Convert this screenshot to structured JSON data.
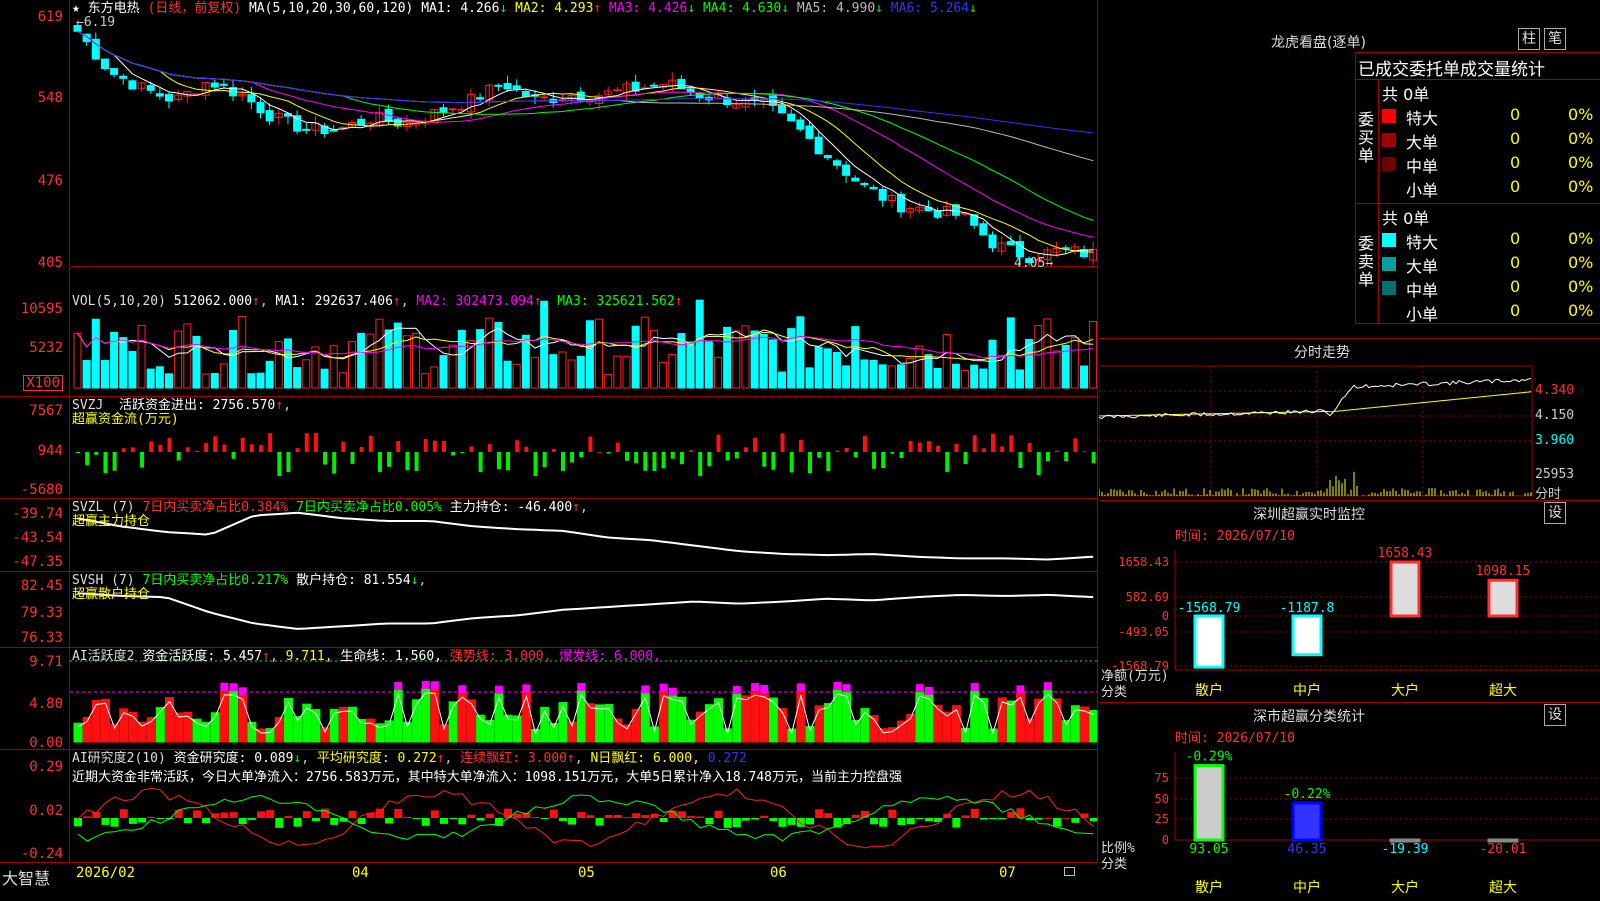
{
  "stock": {
    "name": "东方电热",
    "mode": "(日线，前复权)",
    "high_label": "6.19",
    "low_label": "4.05",
    "star": "★"
  },
  "ma_header": {
    "params": "MA(5,10,20,30,60,120)",
    "items": [
      {
        "label": "MA1:",
        "value": "4.266",
        "arrow": "↓",
        "color": "#ffffff"
      },
      {
        "label": "MA2:",
        "value": "4.293",
        "arrow": "↑",
        "color": "#ffff00"
      },
      {
        "label": "MA3:",
        "value": "4.426",
        "arrow": "↓",
        "color": "#ff00ff"
      },
      {
        "label": "MA4:",
        "value": "4.630",
        "arrow": "↓",
        "color": "#00ff00"
      },
      {
        "label": "MA5:",
        "value": "4.990",
        "arrow": "↓",
        "color": "#bbbbbb"
      },
      {
        "label": "MA6:",
        "value": "5.264",
        "arrow": "↓",
        "color": "#3333ff"
      }
    ]
  },
  "price_axis": [
    "619",
    "548",
    "476",
    "405"
  ],
  "vol": {
    "params": "VOL(5,10,20)",
    "value": "512062.000",
    "ma1": "MA1: 292637.406",
    "ma2": "MA2: 302473.094",
    "ma3": "MA3: 325621.562",
    "axis": [
      "10595",
      "5232",
      "X100"
    ]
  },
  "svzj": {
    "name": "SVZJ",
    "label": "活跃资金进出: 2756.570",
    "sub": "超赢资金流(万元)",
    "axis": [
      "7567",
      "944",
      "-5680"
    ]
  },
  "svzl": {
    "name": "SVZL (7)",
    "buy": "7日内买卖净占比0.384%",
    "buy2": "7日内买卖净占比0.005%",
    "hold": "主力持仓: -46.400",
    "sub": "超赢主力持仓",
    "axis": [
      "-39.74",
      "-43.54",
      "-47.35"
    ]
  },
  "svsh": {
    "name": "SVSH (7)",
    "buy": "7日内买卖净占比0.217%",
    "hold": "散户持仓: 81.554",
    "sub": "超赢散户持仓",
    "axis": [
      "82.45",
      "79.33",
      "76.33"
    ]
  },
  "ai1": {
    "name": "AI活跃度2",
    "active": "资金活跃度: 5.457",
    "v2": "9.711,",
    "life": "生命线: 1.560,",
    "strong": "强势线: 3.000,",
    "burst": "爆发线: 6.000,",
    "axis": [
      "9.71",
      "4.80",
      "0.00"
    ]
  },
  "ai2": {
    "name": "AI研究度2(10)",
    "research": "资金研究度: 0.089",
    "avg": "平均研究度: 0.272",
    "cont": "连续飘红: 3.000",
    "nday": "N日飘红: 6.000,",
    "last": "0.272",
    "axis": [
      "0.29",
      "0.02",
      "-0.24"
    ],
    "note": "近期大资金非常活跃，今日大单净流入：2756.583万元，其中特大单净流入：1098.151万元，大单5日累计净入18.748万元，当前主力控盘强"
  },
  "bottom": {
    "logo": "大智慧",
    "dates": [
      "2026/02",
      "04",
      "05",
      "06",
      "07"
    ]
  },
  "right": {
    "lhb_title": "龙虎看盘(逐单)",
    "btn_bar": "柱",
    "btn_pen": "笔",
    "stat_title": "已成交委托单成交量统计",
    "buy": {
      "label": "委买单",
      "total": "共 0单",
      "rows": [
        {
          "name": "特大",
          "qty": "0",
          "pct": "0%",
          "color": "#ff0000"
        },
        {
          "name": "大单",
          "qty": "0",
          "pct": "0%",
          "color": "#a00000"
        },
        {
          "name": "中单",
          "qty": "0",
          "pct": "0%",
          "color": "#700000"
        },
        {
          "name": "小单",
          "qty": "0",
          "pct": "0%",
          "color": "#000000"
        }
      ]
    },
    "sell": {
      "label": "委卖单",
      "total": "共 0单",
      "rows": [
        {
          "name": "特大",
          "qty": "0",
          "pct": "0%",
          "color": "#00ffff"
        },
        {
          "name": "大单",
          "qty": "0",
          "pct": "0%",
          "color": "#00a0a0"
        },
        {
          "name": "中单",
          "qty": "0",
          "pct": "0%",
          "color": "#007070"
        },
        {
          "name": "小单",
          "qty": "0",
          "pct": "0%",
          "color": "#000000"
        }
      ]
    },
    "minute": {
      "title": "分时走势",
      "axis": [
        "4.340",
        "4.150",
        "3.960",
        "25953"
      ],
      "foot": "分时"
    },
    "sz_monitor": {
      "title": "深圳超赢实时监控",
      "btn": "设",
      "time": "时间: 2026/07/10",
      "axis": [
        "1658.43",
        "582.69",
        "0",
        "-493.05",
        "-1568.79"
      ],
      "ylabel": "净额(万元)",
      "xlabel": "分类",
      "bars": [
        {
          "cat": "散户",
          "value": -1568.79,
          "label": "-1568.79"
        },
        {
          "cat": "中户",
          "value": -1187.8,
          "label": "-1187.8"
        },
        {
          "cat": "大户",
          "value": 1658.43,
          "label": "1658.43"
        },
        {
          "cat": "超大",
          "value": 1098.15,
          "label": "1098.15"
        }
      ]
    },
    "sz_class": {
      "title": "深市超赢分类统计",
      "btn": "设",
      "time": "时间: 2026/07/10",
      "axis": [
        "75",
        "50",
        "25",
        "0"
      ],
      "ylabel": "比例%",
      "xlabel": "分类",
      "bars": [
        {
          "cat": "散户",
          "pct": 93.05,
          "label": "93.05",
          "delta": "-0.29%"
        },
        {
          "cat": "中户",
          "pct": 46.35,
          "label": "46.35",
          "delta": "-0.22%"
        },
        {
          "cat": "大户",
          "pct": -19.39,
          "label": "-19.39",
          "delta": ""
        },
        {
          "cat": "超大",
          "pct": -20.01,
          "label": "-20.01",
          "delta": ""
        }
      ]
    }
  },
  "colors": {
    "up": "#ff2020",
    "down": "#00ffff",
    "grid": "#a00000",
    "yellow": "#ffff00",
    "green": "#00ff00",
    "magenta": "#ff00ff"
  }
}
